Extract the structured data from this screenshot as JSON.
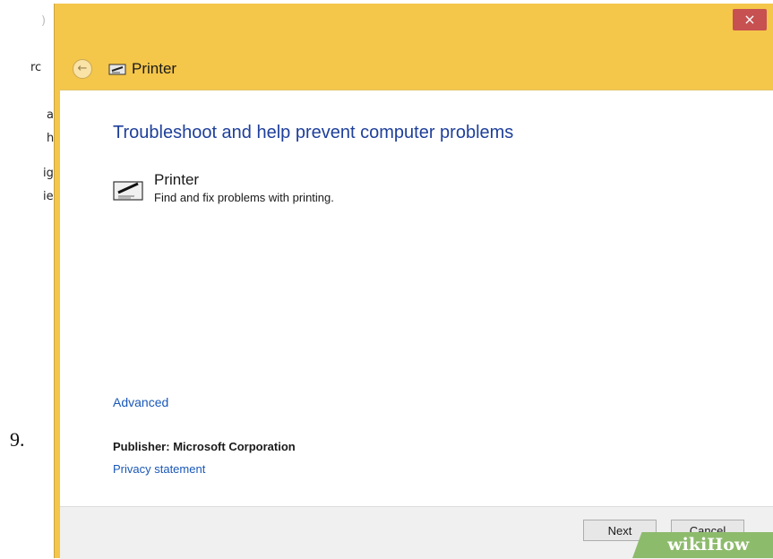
{
  "background_window": {
    "fragments": [
      ")",
      "rc",
      "a",
      "h",
      "ig",
      "ie"
    ]
  },
  "step_number": "9.",
  "dialog": {
    "close_symbol": "×",
    "back_symbol": "←",
    "title": "Printer",
    "heading": "Troubleshoot and help prevent computer problems",
    "item": {
      "title": "Printer",
      "description": "Find and fix problems with printing."
    },
    "advanced_link": "Advanced",
    "publisher_label": "Publisher:",
    "publisher_name": "Microsoft Corporation",
    "privacy_link": "Privacy statement",
    "buttons": {
      "next": "Next",
      "cancel": "Cancel"
    }
  },
  "watermark": {
    "wiki": "wiki",
    "how": "How"
  },
  "colors": {
    "titlebar": "#f4c64a",
    "close": "#c75050",
    "heading": "#1e3f9a",
    "link": "#1a58b8",
    "watermark": "#8dbb6c"
  }
}
